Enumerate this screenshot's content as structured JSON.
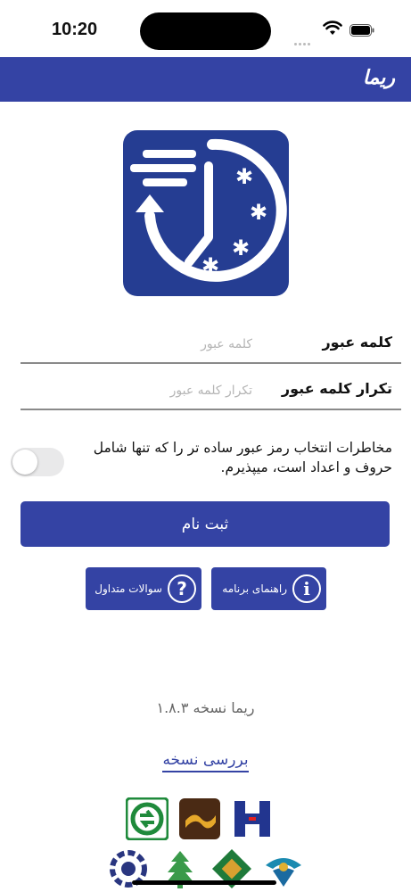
{
  "status": {
    "time": "10:20"
  },
  "header": {
    "title": "ریما"
  },
  "form": {
    "password_label": "کلمه عبور",
    "password_placeholder": "کلمه عبور",
    "repeat_label": "تکرار کلمه عبور",
    "repeat_placeholder": "تکرار کلمه عبور",
    "warning_text": "مخاطرات انتخاب رمز عبور ساده تر را که تنها شامل حروف و اعداد است، میپذیرم.",
    "accept_risk_toggle": false,
    "register_label": "ثبت نام"
  },
  "help": {
    "guide_label": "راهنمای برنامه",
    "faq_label": "سوالات متداول"
  },
  "footer": {
    "version_text": "ریما نسخه ۱.۸.۳",
    "check_version_label": "بررسی نسخه"
  },
  "colors": {
    "primary": "#3443a4",
    "header": "#3443a4"
  },
  "icons": [
    "wifi-icon",
    "battery-icon",
    "app-logo-clock-icon",
    "info-icon",
    "question-icon"
  ]
}
